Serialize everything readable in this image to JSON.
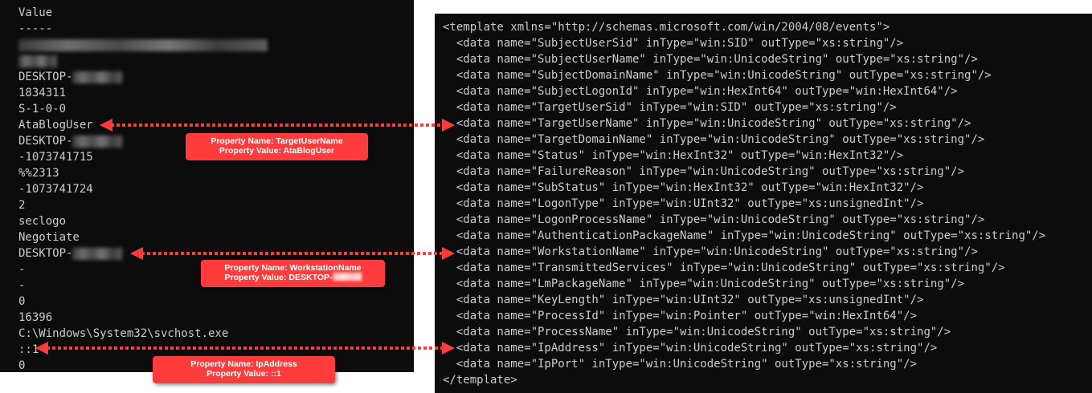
{
  "left_console": {
    "lines": [
      "Value",
      "-----",
      "",
      "",
      "DESKTOP-",
      "1834311",
      "S-1-0-0",
      "AtaBlogUser",
      "DESKTOP-",
      "-1073741715",
      "%%2313",
      "-1073741724",
      "2",
      "seclogo",
      "Negotiate",
      "DESKTOP-",
      "-",
      "-",
      "0",
      "16396",
      "C:\\Windows\\System32\\svchost.exe",
      "::1",
      "0"
    ]
  },
  "right_console": {
    "lines": [
      "<template xmlns=\"http://schemas.microsoft.com/win/2004/08/events\">",
      "  <data name=\"SubjectUserSid\" inType=\"win:SID\" outType=\"xs:string\"/>",
      "  <data name=\"SubjectUserName\" inType=\"win:UnicodeString\" outType=\"xs:string\"/>",
      "  <data name=\"SubjectDomainName\" inType=\"win:UnicodeString\" outType=\"xs:string\"/>",
      "  <data name=\"SubjectLogonId\" inType=\"win:HexInt64\" outType=\"win:HexInt64\"/>",
      "  <data name=\"TargetUserSid\" inType=\"win:SID\" outType=\"xs:string\"/>",
      "  <data name=\"TargetUserName\" inType=\"win:UnicodeString\" outType=\"xs:string\"/>",
      "  <data name=\"TargetDomainName\" inType=\"win:UnicodeString\" outType=\"xs:string\"/>",
      "  <data name=\"Status\" inType=\"win:HexInt32\" outType=\"win:HexInt32\"/>",
      "  <data name=\"FailureReason\" inType=\"win:UnicodeString\" outType=\"xs:string\"/>",
      "  <data name=\"SubStatus\" inType=\"win:HexInt32\" outType=\"win:HexInt32\"/>",
      "  <data name=\"LogonType\" inType=\"win:UInt32\" outType=\"xs:unsignedInt\"/>",
      "  <data name=\"LogonProcessName\" inType=\"win:UnicodeString\" outType=\"xs:string\"/>",
      "  <data name=\"AuthenticationPackageName\" inType=\"win:UnicodeString\" outType=\"xs:string\"/>",
      "  <data name=\"WorkstationName\" inType=\"win:UnicodeString\" outType=\"xs:string\"/>",
      "  <data name=\"TransmittedServices\" inType=\"win:UnicodeString\" outType=\"xs:string\"/>",
      "  <data name=\"LmPackageName\" inType=\"win:UnicodeString\" outType=\"xs:string\"/>",
      "  <data name=\"KeyLength\" inType=\"win:UInt32\" outType=\"xs:unsignedInt\"/>",
      "  <data name=\"ProcessId\" inType=\"win:Pointer\" outType=\"win:HexInt64\"/>",
      "  <data name=\"ProcessName\" inType=\"win:UnicodeString\" outType=\"xs:string\"/>",
      "  <data name=\"IpAddress\" inType=\"win:UnicodeString\" outType=\"xs:string\"/>",
      "  <data name=\"IpPort\" inType=\"win:UnicodeString\" outType=\"xs:string\"/>",
      "</template>"
    ]
  },
  "callouts": [
    {
      "name": "Property Name: TargetUserName",
      "value": "Property Value: AtaBlogUser"
    },
    {
      "name": "Property Name: WorkstationName",
      "value": "Property Value: DESKTOP-"
    },
    {
      "name": "Property Name: IpAddress",
      "value": "Property Value: ::1"
    }
  ],
  "colors": {
    "console_bg": "#0c0c0c",
    "console_text": "#cccccc",
    "callout_bg": "#ff3b3b",
    "arrow": "#ff3b3b"
  }
}
